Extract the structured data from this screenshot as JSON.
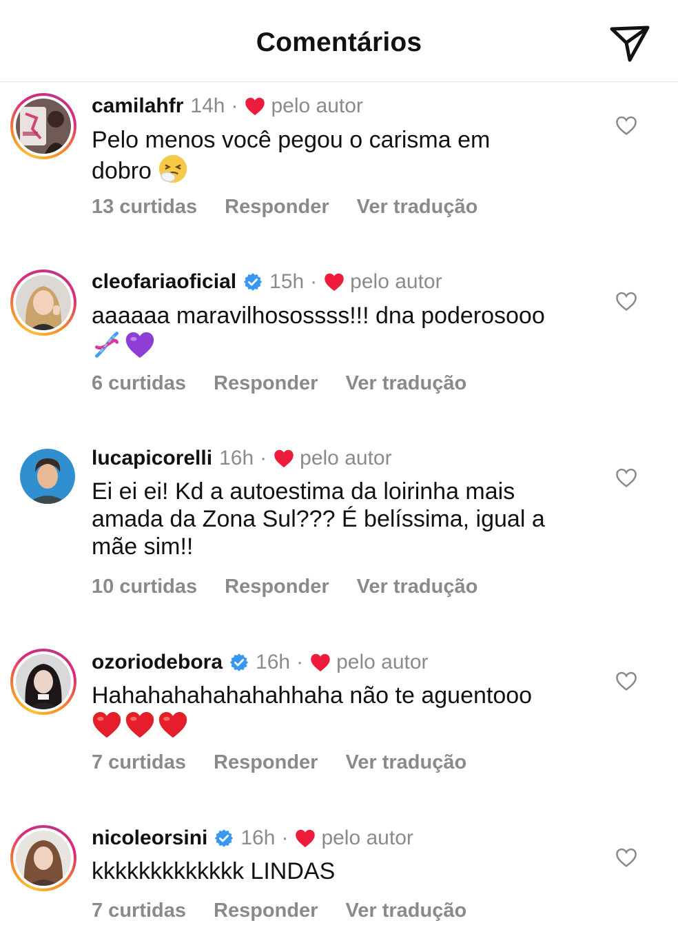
{
  "header": {
    "title": "Comentários",
    "share_icon": "paper-plane-icon"
  },
  "labels": {
    "author_liked": "pelo autor",
    "reply": "Responder",
    "translate": "Ver tradução",
    "dot": "·"
  },
  "colors": {
    "heart": "#ed1c3c",
    "verified": "#3897f0",
    "muted": "#8a8a8a"
  },
  "comments": [
    {
      "username": "camilahfr",
      "verified": false,
      "time": "14h",
      "text_lines": [
        "Pelo menos você pegou o carisma em",
        "dobro"
      ],
      "emojis": [
        "sneezing-face-emoji"
      ],
      "likes": "13 curtidas"
    },
    {
      "username": "cleofariaoficial",
      "verified": true,
      "time": "15h",
      "text_lines": [
        "aaaaaa maravilhosossss!!! dna poderosooo"
      ],
      "emojis": [
        "dna-emoji",
        "purple-heart-emoji"
      ],
      "likes": "6 curtidas"
    },
    {
      "username": "lucapicorelli",
      "verified": false,
      "time": "16h",
      "text_lines": [
        "Ei ei ei! Kd a autoestima da loirinha mais",
        "amada da Zona Sul??? É belíssima, igual a",
        "mãe sim!!"
      ],
      "emojis": [],
      "likes": "10 curtidas"
    },
    {
      "username": "ozoriodebora",
      "verified": true,
      "time": "16h",
      "text_lines": [
        "Hahahahahahahahhaha não te aguentooo"
      ],
      "emojis": [
        "red-heart-emoji",
        "red-heart-emoji",
        "red-heart-emoji"
      ],
      "likes": "7 curtidas"
    },
    {
      "username": "nicoleorsini",
      "verified": true,
      "time": "16h",
      "text_lines": [
        "kkkkkkkkkkkkk LINDAS"
      ],
      "emojis": [],
      "likes": "7 curtidas"
    }
  ]
}
